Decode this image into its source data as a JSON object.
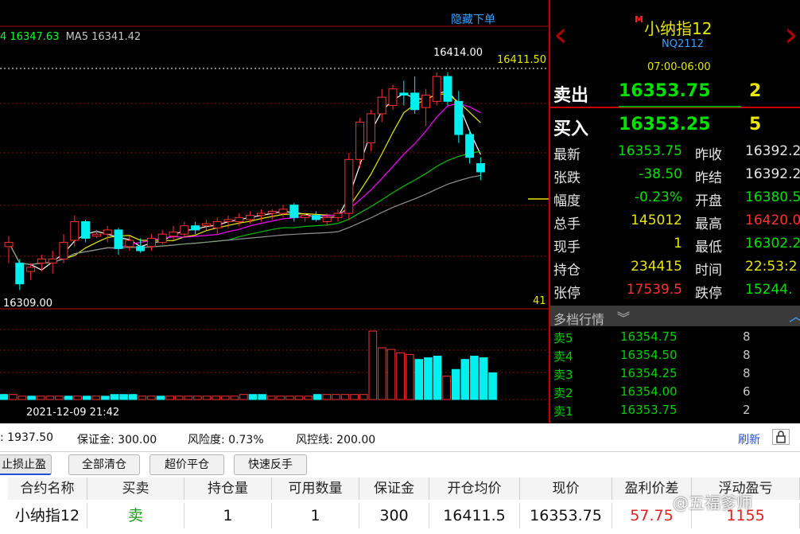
{
  "chart": {
    "ma_line_text": "4 16347.63",
    "ma5_label": "MA5",
    "ma5_value": "16341.42",
    "hide_order_link": "隐藏下单",
    "high_label": "16414.00",
    "low_label": "16309.00",
    "position_price_label": "16411.50",
    "volume_axis_label": "41",
    "timestamp": "2021-12-09 21:42",
    "colors": {
      "up": "#ff3030",
      "down": "#00f0f0",
      "ma_white": "#ffffff",
      "ma_yellow": "#e8e800",
      "ma_magenta": "#ff00ff",
      "ma_green": "#00c000",
      "ma_gray": "#909090"
    }
  },
  "chart_data": {
    "type": "candlestick",
    "price_range": [
      16300,
      16422
    ],
    "candles": [
      {
        "o": 16330,
        "h": 16335,
        "l": 16322,
        "c": 16332
      },
      {
        "o": 16322,
        "h": 16324,
        "l": 16309,
        "c": 16312
      },
      {
        "o": 16318,
        "h": 16322,
        "l": 16314,
        "c": 16320
      },
      {
        "o": 16322,
        "h": 16326,
        "l": 16318,
        "c": 16324
      },
      {
        "o": 16322,
        "h": 16328,
        "l": 16317,
        "c": 16324
      },
      {
        "o": 16324,
        "h": 16336,
        "l": 16322,
        "c": 16332
      },
      {
        "o": 16333,
        "h": 16345,
        "l": 16330,
        "c": 16342
      },
      {
        "o": 16342,
        "h": 16343,
        "l": 16332,
        "c": 16334
      },
      {
        "o": 16335,
        "h": 16338,
        "l": 16334,
        "c": 16336
      },
      {
        "o": 16336,
        "h": 16340,
        "l": 16332,
        "c": 16338
      },
      {
        "o": 16338,
        "h": 16339,
        "l": 16326,
        "c": 16329
      },
      {
        "o": 16330,
        "h": 16335,
        "l": 16328,
        "c": 16333
      },
      {
        "o": 16330,
        "h": 16334,
        "l": 16327,
        "c": 16328
      },
      {
        "o": 16330,
        "h": 16336,
        "l": 16328,
        "c": 16334
      },
      {
        "o": 16332,
        "h": 16338,
        "l": 16331,
        "c": 16336
      },
      {
        "o": 16335,
        "h": 16340,
        "l": 16333,
        "c": 16337
      },
      {
        "o": 16336,
        "h": 16342,
        "l": 16335,
        "c": 16340
      },
      {
        "o": 16340,
        "h": 16342,
        "l": 16336,
        "c": 16338
      },
      {
        "o": 16340,
        "h": 16343,
        "l": 16338,
        "c": 16341
      },
      {
        "o": 16339,
        "h": 16344,
        "l": 16336,
        "c": 16342
      },
      {
        "o": 16342,
        "h": 16345,
        "l": 16339,
        "c": 16343
      },
      {
        "o": 16342,
        "h": 16346,
        "l": 16340,
        "c": 16344
      },
      {
        "o": 16343,
        "h": 16347,
        "l": 16341,
        "c": 16345
      },
      {
        "o": 16345,
        "h": 16348,
        "l": 16342,
        "c": 16346
      },
      {
        "o": 16346,
        "h": 16348,
        "l": 16343,
        "c": 16347
      },
      {
        "o": 16346,
        "h": 16350,
        "l": 16344,
        "c": 16348
      },
      {
        "o": 16350,
        "h": 16351,
        "l": 16342,
        "c": 16344
      },
      {
        "o": 16344,
        "h": 16346,
        "l": 16342,
        "c": 16345
      },
      {
        "o": 16345,
        "h": 16347,
        "l": 16342,
        "c": 16343
      },
      {
        "o": 16342,
        "h": 16346,
        "l": 16340,
        "c": 16344
      },
      {
        "o": 16344,
        "h": 16348,
        "l": 16342,
        "c": 16346
      },
      {
        "o": 16346,
        "h": 16375,
        "l": 16343,
        "c": 16372
      },
      {
        "o": 16372,
        "h": 16392,
        "l": 16368,
        "c": 16390
      },
      {
        "o": 16380,
        "h": 16396,
        "l": 16376,
        "c": 16394
      },
      {
        "o": 16394,
        "h": 16406,
        "l": 16390,
        "c": 16402
      },
      {
        "o": 16398,
        "h": 16408,
        "l": 16396,
        "c": 16406
      },
      {
        "o": 16404,
        "h": 16410,
        "l": 16398,
        "c": 16403
      },
      {
        "o": 16404,
        "h": 16412,
        "l": 16394,
        "c": 16396
      },
      {
        "o": 16397,
        "h": 16406,
        "l": 16388,
        "c": 16403
      },
      {
        "o": 16400,
        "h": 16414,
        "l": 16398,
        "c": 16412
      },
      {
        "o": 16412,
        "h": 16414,
        "l": 16398,
        "c": 16400
      },
      {
        "o": 16400,
        "h": 16405,
        "l": 16380,
        "c": 16384
      },
      {
        "o": 16384,
        "h": 16386,
        "l": 16370,
        "c": 16373
      },
      {
        "o": 16370,
        "h": 16373,
        "l": 16362,
        "c": 16366
      }
    ],
    "volumes": [
      3,
      3,
      2,
      2,
      2,
      2,
      2,
      2,
      2,
      2,
      2,
      2,
      3,
      3,
      3,
      2,
      2,
      2,
      2,
      2,
      2,
      2,
      2,
      2,
      2,
      2,
      3,
      3,
      3,
      2,
      2,
      2,
      2,
      2,
      3,
      3,
      3,
      3,
      3,
      3,
      41,
      31,
      30,
      28,
      27,
      24,
      25,
      26,
      14,
      18,
      24,
      26,
      25,
      16
    ],
    "volume_up": [
      false,
      true,
      true,
      false,
      true,
      true,
      true,
      false,
      true,
      false,
      true,
      false,
      false,
      false,
      false,
      true,
      true,
      false,
      true,
      true,
      true,
      true,
      true,
      true,
      true,
      true,
      true,
      false,
      false,
      true,
      true,
      true,
      true,
      true,
      false,
      true,
      true,
      true,
      true,
      true,
      true,
      true,
      true,
      true,
      true,
      false,
      false,
      false,
      true,
      false,
      false,
      false,
      false,
      false
    ]
  },
  "quote": {
    "contract_name": "小纳指12",
    "contract_code": "NQ2112",
    "trading_hours": "07:00-06:00",
    "sell_label": "卖出",
    "sell_price": "16353.75",
    "sell_qty": "2",
    "buy_label": "买入",
    "buy_price": "16353.25",
    "buy_qty": "5",
    "rows": [
      {
        "l1": "最新",
        "v1": "16353.75",
        "c1": "#00e000",
        "l2": "昨收",
        "v2": "16392.2",
        "c2": "#e6e6e6"
      },
      {
        "l1": "张跌",
        "v1": "-38.50",
        "c1": "#00e000",
        "l2": "昨结",
        "v2": "16392.2",
        "c2": "#e6e6e6"
      },
      {
        "l1": "幅度",
        "v1": "-0.23%",
        "c1": "#00e000",
        "l2": "开盘",
        "v2": "16380.5",
        "c2": "#00e000"
      },
      {
        "l1": "总手",
        "v1": "145012",
        "c1": "#e6e600",
        "l2": "最高",
        "v2": "16420.0",
        "c2": "#ff3030"
      },
      {
        "l1": "现手",
        "v1": "1",
        "c1": "#e6e600",
        "l2": "最低",
        "v2": "16302.2",
        "c2": "#00e000"
      },
      {
        "l1": "持仓",
        "v1": "234415",
        "c1": "#e6e600",
        "l2": "时间",
        "v2": "22:53:2",
        "c2": "#e6e600"
      },
      {
        "l1": "张停",
        "v1": "17539.5",
        "c1": "#ff3030",
        "l2": "跌停",
        "v2": "15244.",
        "c2": "#00e000"
      }
    ],
    "depth_title": "多档行情",
    "depth": [
      {
        "label": "卖5",
        "price": "16354.75",
        "vol": "8"
      },
      {
        "label": "卖4",
        "price": "16354.50",
        "vol": "8"
      },
      {
        "label": "卖3",
        "price": "16354.25",
        "vol": "8"
      },
      {
        "label": "卖2",
        "price": "16354.00",
        "vol": "6"
      },
      {
        "label": "卖1",
        "price": "16353.75",
        "vol": "2"
      }
    ]
  },
  "account": {
    "balance": ": 1937.50",
    "margin": "保证金: 300.00",
    "risk": "风险度: 0.73%",
    "risk_line": "风控线: 200.00",
    "refresh": "刷新"
  },
  "actions": {
    "stop": "止损止盈",
    "close_all": "全部清仓",
    "close_over": "超价平仓",
    "reverse": "快速反手"
  },
  "table": {
    "headers": [
      "合约名称",
      "买卖",
      "持仓量",
      "可用数量",
      "保证金",
      "开仓均价",
      "现价",
      "盈利价差",
      "浮动盈亏"
    ],
    "row": [
      "小纳指12",
      "卖",
      "1",
      "1",
      "300",
      "16411.5",
      "16353.75",
      "57.75",
      "1155"
    ]
  },
  "watermark": "@五福爹师"
}
